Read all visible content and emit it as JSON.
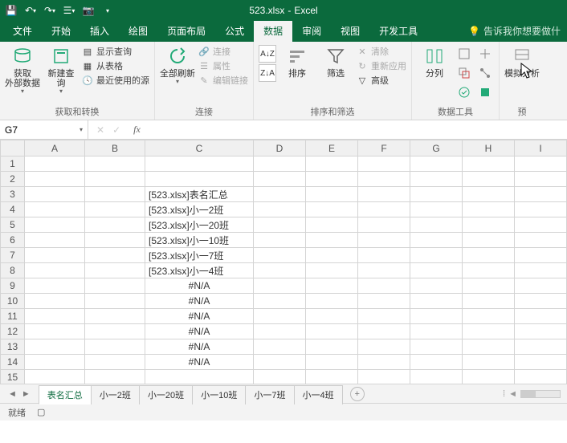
{
  "title": {
    "filename": "523.xlsx",
    "app": "Excel"
  },
  "qat": [
    "save",
    "undo",
    "redo",
    "touch",
    "camera"
  ],
  "tabs": {
    "items": [
      "文件",
      "开始",
      "插入",
      "绘图",
      "页面布局",
      "公式",
      "数据",
      "审阅",
      "视图",
      "开发工具"
    ],
    "active_index": 6,
    "tell_me": "告诉我你想要做什"
  },
  "ribbon": {
    "group1": {
      "label": "获取和转换",
      "btn1": "获取\n外部数据",
      "btn2": "新建查\n询",
      "items": [
        "显示查询",
        "从表格",
        "最近使用的源"
      ]
    },
    "group2": {
      "label": "连接",
      "btn": "全部刷新",
      "items": [
        "连接",
        "属性",
        "编辑链接"
      ]
    },
    "group3": {
      "label": "排序和筛选",
      "btn_sort": "排序",
      "btn_filter": "筛选",
      "items": [
        "清除",
        "重新应用",
        "高级"
      ]
    },
    "group4": {
      "label": "数据工具",
      "btn": "分列"
    },
    "group5": {
      "label": "预",
      "btn": "模拟分析"
    }
  },
  "namebox": {
    "ref": "G7"
  },
  "columns": [
    "A",
    "B",
    "C",
    "D",
    "E",
    "F",
    "G",
    "H",
    "I"
  ],
  "rows_visible": 15,
  "cells": {
    "C3": "[523.xlsx]表名汇总",
    "C4": "[523.xlsx]小一2班",
    "C5": "[523.xlsx]小一20班",
    "C6": "[523.xlsx]小一10班",
    "C7": "[523.xlsx]小一7班",
    "C8": "[523.xlsx]小一4班",
    "C9": "#N/A",
    "C10": "#N/A",
    "C11": "#N/A",
    "C12": "#N/A",
    "C13": "#N/A",
    "C14": "#N/A"
  },
  "sheets": {
    "items": [
      "表名汇总",
      "小一2班",
      "小一20班",
      "小一10班",
      "小一7班",
      "小一4班"
    ],
    "active_index": 0
  },
  "statusbar": {
    "status": "就绪"
  }
}
